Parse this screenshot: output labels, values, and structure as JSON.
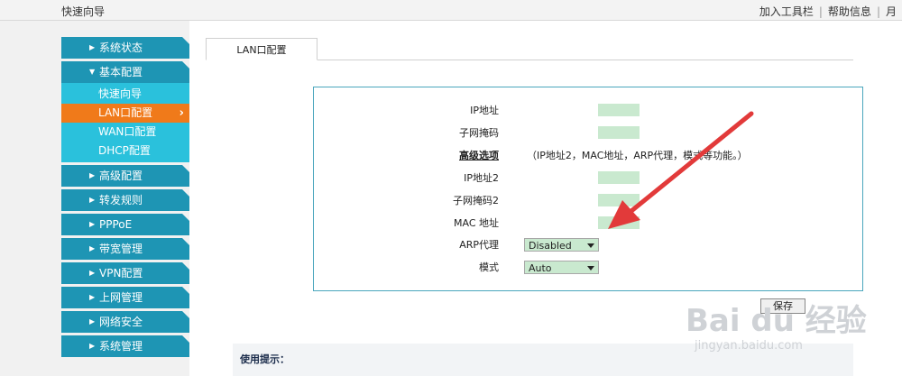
{
  "topbar": {
    "title": "快速向导",
    "links": [
      "加入工具栏",
      "帮助信息",
      "月"
    ]
  },
  "sidebar": {
    "items_top": [
      {
        "label": "系统状态",
        "arrow": "▶"
      },
      {
        "label": "基本配置",
        "arrow": "▼"
      }
    ],
    "subitems": [
      {
        "label": "快速向导"
      },
      {
        "label": "LAN口配置",
        "chevron": "›"
      },
      {
        "label": "WAN口配置"
      },
      {
        "label": "DHCP配置"
      }
    ],
    "items_bottom": [
      {
        "label": "高级配置",
        "arrow": "▶"
      },
      {
        "label": "转发规则",
        "arrow": "▶"
      },
      {
        "label": "PPPoE",
        "arrow": "▶"
      },
      {
        "label": "带宽管理",
        "arrow": "▶"
      },
      {
        "label": "VPN配置",
        "arrow": "▶"
      },
      {
        "label": "上网管理",
        "arrow": "▶"
      },
      {
        "label": "网络安全",
        "arrow": "▶"
      },
      {
        "label": "系统管理",
        "arrow": "▶"
      }
    ]
  },
  "tab": {
    "label": "LAN口配置"
  },
  "form": {
    "ip_label": "IP地址",
    "mask_label": "子网掩码",
    "advanced_label": "高级选项",
    "advanced_note": "（IP地址2，MAC地址，ARP代理，模式等功能。）",
    "ip2_label": "IP地址2",
    "mask2_label": "子网掩码2",
    "mac_label": "MAC 地址",
    "arp_label": "ARP代理",
    "arp_value": "Disabled",
    "mode_label": "模式",
    "mode_value": "Auto"
  },
  "save_label": "保存",
  "tip": {
    "label": "使用提示："
  },
  "watermark": {
    "brand": "Bai du 经验",
    "url": "jingyan.baidu.com"
  },
  "colors": {
    "nav": "#1e95b4",
    "sub": "#2ac1dc",
    "active": "#f07a1a",
    "arrow": "#e23a3a",
    "field": "#c9e9cf"
  }
}
